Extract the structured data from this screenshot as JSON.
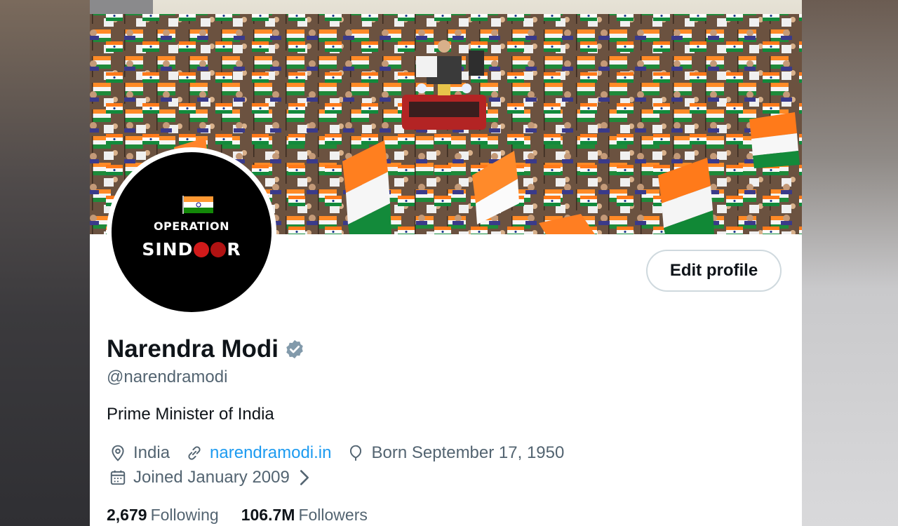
{
  "profile": {
    "name": "Narendra Modi",
    "handle": "@narendramodi",
    "bio": "Prime Minister of India",
    "location": "India",
    "website": "narendramodi.in",
    "birthday": "Born September 17, 1950",
    "joined": "Joined January 2009",
    "following_count": "2,679",
    "following_label": "Following",
    "followers_count": "106.7M",
    "followers_label": "Followers",
    "edit_button_label": "Edit profile"
  },
  "avatar": {
    "line1": "OPERATION",
    "line2_part1": "SIND",
    "line2_part2": "R"
  },
  "icons": {
    "location": "location-pin-icon",
    "link": "link-icon",
    "birthday": "balloon-icon",
    "calendar": "calendar-icon",
    "verified": "verified-badge-icon"
  },
  "colors": {
    "link": "#1d9bf0",
    "secondary_text": "#536471",
    "verified_badge": "#829aab",
    "primary_text": "#0f1419"
  }
}
